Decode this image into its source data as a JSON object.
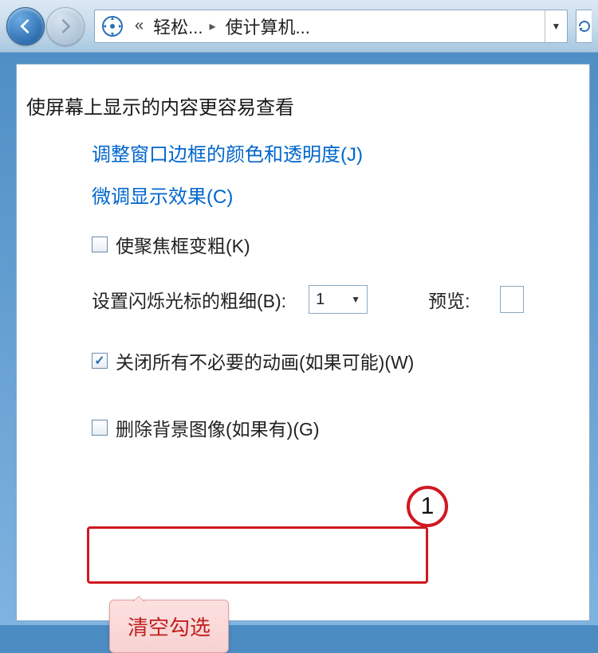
{
  "nav": {
    "crumb1": "轻松...",
    "crumb2": "使计算机..."
  },
  "section": {
    "title": "使屏幕上显示的内容更容易查看"
  },
  "links": {
    "adjust_color": "调整窗口边框的颜色和透明度(J)",
    "fine_tune": "微调显示效果(C)"
  },
  "options": {
    "focus_thick": "使聚焦框变粗(K)",
    "cursor_label": "设置闪烁光标的粗细(B):",
    "cursor_value": "1",
    "preview_label": "预览:",
    "disable_anim": "关闭所有不必要的动画(如果可能)(W)",
    "remove_bg": "删除背景图像(如果有)(G)"
  },
  "callout": {
    "number": "1",
    "tooltip": "清空勾选"
  }
}
